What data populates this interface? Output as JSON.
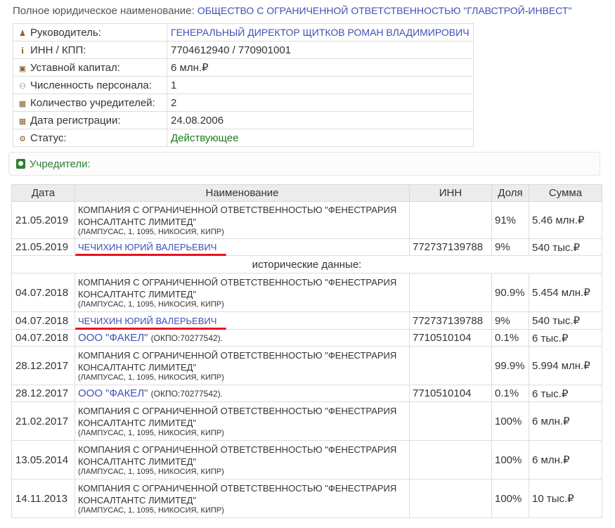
{
  "full_name": {
    "label": "Полное юридическое наименование:",
    "value": "ОБЩЕСТВО С ОГРАНИЧЕННОЙ ОТВЕТСТВЕННОСТЬЮ \"ГЛАВСТРОЙ-ИНВЕСТ\""
  },
  "info": {
    "director": {
      "icon": "person-icon",
      "label": "Руководитель:",
      "value": "ГЕНЕРАЛЬНЫЙ ДИРЕКТОР ЩИТКОВ РОМАН ВЛАДИМИРОВИЧ"
    },
    "inn": {
      "icon": "info-icon",
      "label": "ИНН / КПП:",
      "value": "7704612940 / 770901001"
    },
    "capital": {
      "icon": "money-icon",
      "label": "Уставной капитал:",
      "value": "6 млн.₽"
    },
    "staff": {
      "icon": "users-icon",
      "label": "Численность персонала:",
      "value": "1"
    },
    "founders_count": {
      "icon": "founder-icon",
      "label": "Количество учредителей:",
      "value": "2"
    },
    "reg_date": {
      "icon": "calendar-icon",
      "label": "Дата регистрации:",
      "value": "24.08.2006"
    },
    "status": {
      "icon": "gears-icon",
      "label": "Статус:",
      "value": "Действующее"
    }
  },
  "founders_panel": {
    "icon": "founders-icon",
    "title": "Учредители:"
  },
  "table": {
    "headers": {
      "date": "Дата",
      "name": "Наименование",
      "inn": "ИНН",
      "share": "Доля",
      "sum": "Сумма"
    },
    "historical_label": "исторические данные:",
    "rows": [
      {
        "date": "21.05.2019",
        "name": "КОМПАНИЯ С ОГРАНИЧЕННОЙ ОТВЕТСТВЕННОСТЬЮ \"ФЕНЕСТРАРИЯ КОНСАЛТАНТС ЛИМИТЕД\"",
        "addr": "(ЛАМПУСАС, 1, 1095, НИКОСИЯ, КИПР)",
        "inn": "",
        "share": "91%",
        "sum": "5.46 млн.₽"
      },
      {
        "date": "21.05.2019",
        "person": "ЧЕЧИХИН ЮРИЙ ВАЛЕРЬЕВИЧ",
        "inn": "772737139788",
        "share": "9%",
        "sum": "540 тыс.₽"
      },
      {
        "date": "04.07.2018",
        "name": "КОМПАНИЯ С ОГРАНИЧЕННОЙ ОТВЕТСТВЕННОСТЬЮ \"ФЕНЕСТРАРИЯ КОНСАЛТАНТС ЛИМИТЕД\"",
        "addr": "(ЛАМПУСАС, 1, 1095, НИКОСИЯ, КИПР)",
        "inn": "",
        "share": "90.9%",
        "sum": "5.454 млн.₽"
      },
      {
        "date": "04.07.2018",
        "person": "ЧЕЧИХИН ЮРИЙ ВАЛЕРЬЕВИЧ",
        "inn": "772737139788",
        "share": "9%",
        "sum": "540 тыс.₽"
      },
      {
        "date": "04.07.2018",
        "org": "ООО \"ФАКЕЛ\"",
        "okpo": "(ОКПО:70277542).",
        "inn": "7710510104",
        "share": "0.1%",
        "sum": "6 тыс.₽"
      },
      {
        "date": "28.12.2017",
        "name": "КОМПАНИЯ С ОГРАНИЧЕННОЙ ОТВЕТСТВЕННОСТЬЮ \"ФЕНЕСТРАРИЯ КОНСАЛТАНТС ЛИМИТЕД\"",
        "addr": "(ЛАМПУСАС, 1, 1095, НИКОСИЯ, КИПР)",
        "inn": "",
        "share": "99.9%",
        "sum": "5.994 млн.₽"
      },
      {
        "date": "28.12.2017",
        "org": "ООО \"ФАКЕЛ\"",
        "okpo": "(ОКПО:70277542).",
        "inn": "7710510104",
        "share": "0.1%",
        "sum": "6 тыс.₽"
      },
      {
        "date": "21.02.2017",
        "name": "КОМПАНИЯ С ОГРАНИЧЕННОЙ ОТВЕТСТВЕННОСТЬЮ \"ФЕНЕСТРАРИЯ КОНСАЛТАНТС ЛИМИТЕД\"",
        "addr": "(ЛАМПУСАС, 1, 1095, НИКОСИЯ, КИПР)",
        "inn": "",
        "share": "100%",
        "sum": "6 млн.₽"
      },
      {
        "date": "13.05.2014",
        "name": "КОМПАНИЯ С ОГРАНИЧЕННОЙ ОТВЕТСТВЕННОСТЬЮ \"ФЕНЕСТРАРИЯ КОНСАЛТАНТС ЛИМИТЕД\"",
        "addr": "(ЛАМПУСАС, 1, 1095, НИКОСИЯ, КИПР)",
        "inn": "",
        "share": "100%",
        "sum": "6 млн.₽"
      },
      {
        "date": "14.11.2013",
        "name": "КОМПАНИЯ С ОГРАНИЧЕННОЙ ОТВЕТСТВЕННОСТЬЮ \"ФЕНЕСТРАРИЯ КОНСАЛТАНТС ЛИМИТЕД\"",
        "addr": "(ЛАМПУСАС, 1, 1095, НИКОСИЯ, КИПР)",
        "inn": "",
        "share": "100%",
        "sum": "10 тыс.₽"
      }
    ]
  }
}
